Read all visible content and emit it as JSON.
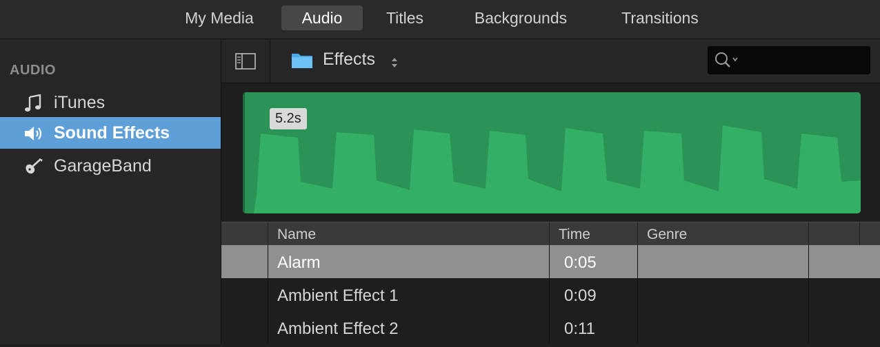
{
  "top_tabs": [
    {
      "label": "My Media",
      "active": false
    },
    {
      "label": "Audio",
      "active": true
    },
    {
      "label": "Titles",
      "active": false
    },
    {
      "label": "Backgrounds",
      "active": false
    },
    {
      "label": "Transitions",
      "active": false
    }
  ],
  "sidebar": {
    "heading": "AUDIO",
    "items": [
      {
        "label": "iTunes",
        "icon": "music-note-icon",
        "selected": false
      },
      {
        "label": "Sound Effects",
        "icon": "speaker-icon",
        "selected": true
      },
      {
        "label": "GarageBand",
        "icon": "guitar-icon",
        "selected": false
      }
    ]
  },
  "toolbar": {
    "folder_label": "Effects",
    "search_placeholder": ""
  },
  "preview": {
    "duration": "5.2s",
    "waveform_color": "#33b065"
  },
  "table": {
    "columns": [
      "Name",
      "Time",
      "Genre"
    ],
    "rows": [
      {
        "name": "Alarm",
        "time": "0:05",
        "genre": "",
        "selected": true
      },
      {
        "name": "Ambient Effect 1",
        "time": "0:09",
        "genre": "",
        "selected": false
      },
      {
        "name": "Ambient Effect 2",
        "time": "0:11",
        "genre": "",
        "selected": false
      }
    ]
  },
  "colors": {
    "selection_blue": "#5f9fd8",
    "row_selected": "#909090"
  }
}
